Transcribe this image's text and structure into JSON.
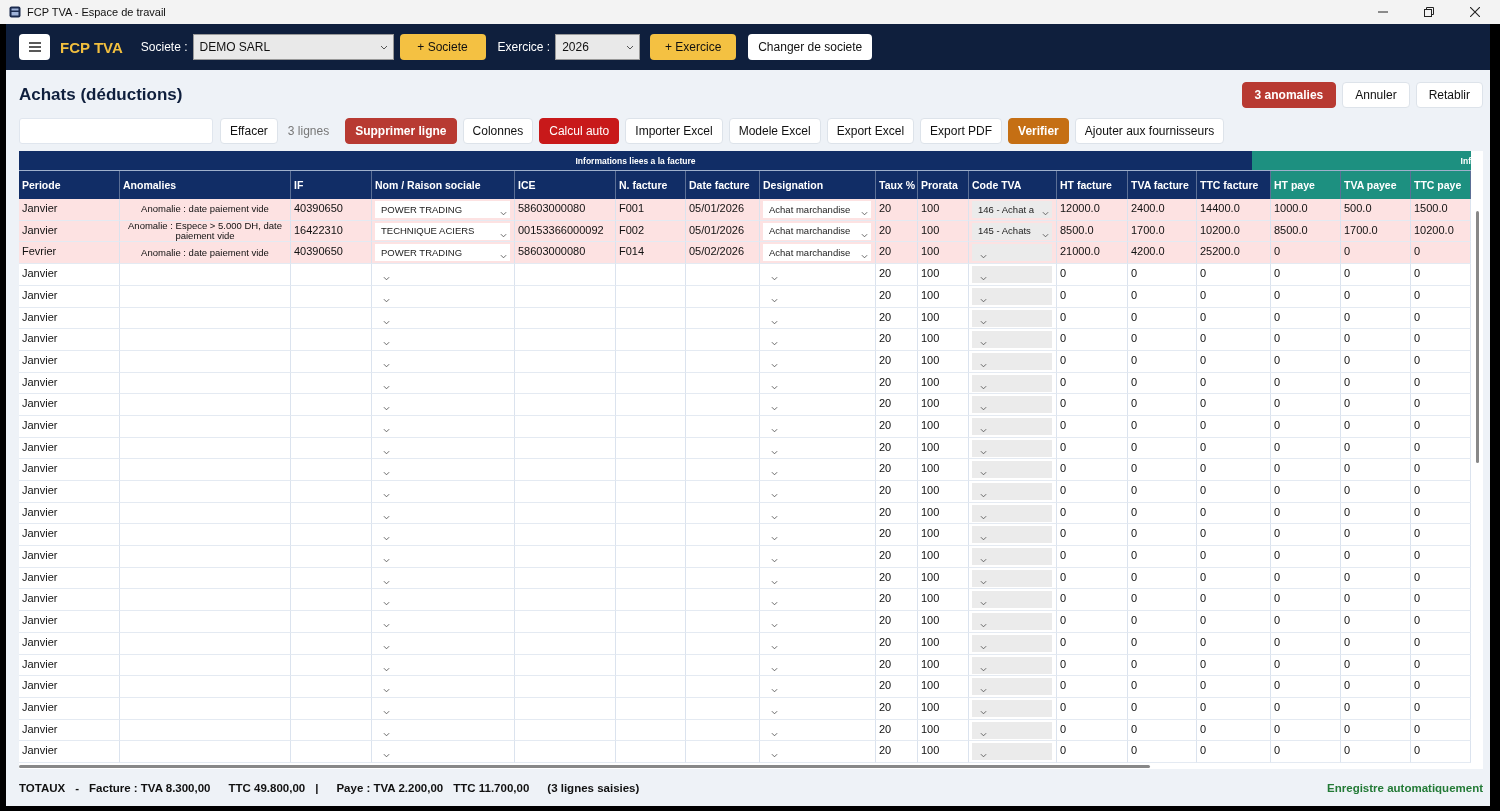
{
  "window": {
    "title": "FCP TVA - Espace de travail"
  },
  "header": {
    "brand": "FCP TVA",
    "company_label": "Societe :",
    "company": "DEMO SARL",
    "add_company": "+ Societe",
    "year_label": "Exercice :",
    "year": "2026",
    "add_year": "+ Exercice",
    "switch_company": "Changer de societe"
  },
  "page_title": "Achats (déductions)",
  "top_actions": [
    {
      "label": "3 anomalies",
      "kind": "danger"
    },
    {
      "label": "Annuler",
      "kind": "plain"
    },
    {
      "label": "Retablir",
      "kind": "plain"
    }
  ],
  "toolbar": {
    "clear": "Effacer",
    "count": "3 lignes",
    "buttons": [
      {
        "label": "Supprimer ligne",
        "kind": "danger"
      },
      {
        "label": "Colonnes",
        "kind": "plain"
      },
      {
        "label": "Calcul auto",
        "kind": "alert"
      },
      {
        "label": "Importer Excel",
        "kind": "plain"
      },
      {
        "label": "Modele Excel",
        "kind": "plain"
      },
      {
        "label": "Export Excel",
        "kind": "plain"
      },
      {
        "label": "Export PDF",
        "kind": "plain"
      },
      {
        "label": "Verifier",
        "kind": "warning"
      },
      {
        "label": "Ajouter aux fournisseurs",
        "kind": "plain"
      }
    ]
  },
  "table": {
    "groups": [
      {
        "label": "Informations liees a la facture",
        "kind": "invoice"
      },
      {
        "label": "Inf",
        "kind": "payment"
      }
    ],
    "columns": [
      {
        "label": "Periode",
        "kind": "text"
      },
      {
        "label": "Anomalies",
        "kind": "note"
      },
      {
        "label": "IF",
        "kind": "text"
      },
      {
        "label": "Nom / Raison sociale",
        "kind": "combo"
      },
      {
        "label": "ICE",
        "kind": "text"
      },
      {
        "label": "N. facture",
        "kind": "text"
      },
      {
        "label": "Date facture",
        "kind": "text"
      },
      {
        "label": "Designation",
        "kind": "combo"
      },
      {
        "label": "Taux %",
        "kind": "text"
      },
      {
        "label": "Prorata",
        "kind": "text"
      },
      {
        "label": "Code TVA",
        "kind": "code"
      },
      {
        "label": "HT facture",
        "kind": "text"
      },
      {
        "label": "TVA facture",
        "kind": "text"
      },
      {
        "label": "TTC facture",
        "kind": "text"
      },
      {
        "label": "HT paye",
        "kind": "paid"
      },
      {
        "label": "TVA payee",
        "kind": "paid"
      },
      {
        "label": "TTC paye",
        "kind": "paid"
      }
    ],
    "rows": [
      {
        "anomaly": true,
        "periode": "Janvier",
        "anomalie": "Anomalie : date paiement vide",
        "if": "40390650",
        "nom": "POWER TRADING",
        "ice": "58603000080",
        "n_facture": "F001",
        "date_facture": "05/01/2026",
        "designation": "Achat marchandise",
        "taux": "20",
        "prorata": "100",
        "code_tva": "146 - Achat a",
        "ht_facture": "12000.0",
        "tva_facture": "2400.0",
        "ttc_facture": "14400.0",
        "ht_paye": "1000.0",
        "tva_payee": "500.0",
        "ttc_paye": "1500.0"
      },
      {
        "anomaly": true,
        "periode": "Janvier",
        "anomalie": "Anomalie : Espece > 5.000 DH, date paiement vide",
        "if": "16422310",
        "nom": "TECHNIQUE ACIERS",
        "ice": "00153366000092",
        "n_facture": "F002",
        "date_facture": "05/01/2026",
        "designation": "Achat marchandise",
        "taux": "20",
        "prorata": "100",
        "code_tva": "145 - Achats",
        "ht_facture": "8500.0",
        "tva_facture": "1700.0",
        "ttc_facture": "10200.0",
        "ht_paye": "8500.0",
        "tva_payee": "1700.0",
        "ttc_paye": "10200.0"
      },
      {
        "anomaly": true,
        "periode": "Fevrier",
        "anomalie": "Anomalie : date paiement vide",
        "if": "40390650",
        "nom": "POWER TRADING",
        "ice": "58603000080",
        "n_facture": "F014",
        "date_facture": "05/02/2026",
        "designation": "Achat marchandise",
        "taux": "20",
        "prorata": "100",
        "ht_facture": "21000.0",
        "tva_facture": "4200.0",
        "ttc_facture": "25200.0",
        "ht_paye": "0",
        "tva_payee": "0",
        "ttc_paye": "0"
      },
      {
        "anomaly": false,
        "periode": "Janvier",
        "taux": "20",
        "prorata": "100",
        "ht_facture": "0",
        "tva_facture": "0",
        "ttc_facture": "0",
        "ht_paye": "0",
        "tva_payee": "0",
        "ttc_paye": "0"
      },
      {
        "anomaly": false,
        "periode": "Janvier",
        "taux": "20",
        "prorata": "100",
        "ht_facture": "0",
        "tva_facture": "0",
        "ttc_facture": "0",
        "ht_paye": "0",
        "tva_payee": "0",
        "ttc_paye": "0"
      },
      {
        "anomaly": false,
        "periode": "Janvier",
        "taux": "20",
        "prorata": "100",
        "ht_facture": "0",
        "tva_facture": "0",
        "ttc_facture": "0",
        "ht_paye": "0",
        "tva_payee": "0",
        "ttc_paye": "0"
      },
      {
        "anomaly": false,
        "periode": "Janvier",
        "taux": "20",
        "prorata": "100",
        "ht_facture": "0",
        "tva_facture": "0",
        "ttc_facture": "0",
        "ht_paye": "0",
        "tva_payee": "0",
        "ttc_paye": "0"
      },
      {
        "anomaly": false,
        "periode": "Janvier",
        "taux": "20",
        "prorata": "100",
        "ht_facture": "0",
        "tva_facture": "0",
        "ttc_facture": "0",
        "ht_paye": "0",
        "tva_payee": "0",
        "ttc_paye": "0"
      },
      {
        "anomaly": false,
        "periode": "Janvier",
        "taux": "20",
        "prorata": "100",
        "ht_facture": "0",
        "tva_facture": "0",
        "ttc_facture": "0",
        "ht_paye": "0",
        "tva_payee": "0",
        "ttc_paye": "0"
      },
      {
        "anomaly": false,
        "periode": "Janvier",
        "taux": "20",
        "prorata": "100",
        "ht_facture": "0",
        "tva_facture": "0",
        "ttc_facture": "0",
        "ht_paye": "0",
        "tva_payee": "0",
        "ttc_paye": "0"
      },
      {
        "anomaly": false,
        "periode": "Janvier",
        "taux": "20",
        "prorata": "100",
        "ht_facture": "0",
        "tva_facture": "0",
        "ttc_facture": "0",
        "ht_paye": "0",
        "tva_payee": "0",
        "ttc_paye": "0"
      },
      {
        "anomaly": false,
        "periode": "Janvier",
        "taux": "20",
        "prorata": "100",
        "ht_facture": "0",
        "tva_facture": "0",
        "ttc_facture": "0",
        "ht_paye": "0",
        "tva_payee": "0",
        "ttc_paye": "0"
      },
      {
        "anomaly": false,
        "periode": "Janvier",
        "taux": "20",
        "prorata": "100",
        "ht_facture": "0",
        "tva_facture": "0",
        "ttc_facture": "0",
        "ht_paye": "0",
        "tva_payee": "0",
        "ttc_paye": "0"
      },
      {
        "anomaly": false,
        "periode": "Janvier",
        "taux": "20",
        "prorata": "100",
        "ht_facture": "0",
        "tva_facture": "0",
        "ttc_facture": "0",
        "ht_paye": "0",
        "tva_payee": "0",
        "ttc_paye": "0"
      },
      {
        "anomaly": false,
        "periode": "Janvier",
        "taux": "20",
        "prorata": "100",
        "ht_facture": "0",
        "tva_facture": "0",
        "ttc_facture": "0",
        "ht_paye": "0",
        "tva_payee": "0",
        "ttc_paye": "0"
      },
      {
        "anomaly": false,
        "periode": "Janvier",
        "taux": "20",
        "prorata": "100",
        "ht_facture": "0",
        "tva_facture": "0",
        "ttc_facture": "0",
        "ht_paye": "0",
        "tva_payee": "0",
        "ttc_paye": "0"
      },
      {
        "anomaly": false,
        "periode": "Janvier",
        "taux": "20",
        "prorata": "100",
        "ht_facture": "0",
        "tva_facture": "0",
        "ttc_facture": "0",
        "ht_paye": "0",
        "tva_payee": "0",
        "ttc_paye": "0"
      },
      {
        "anomaly": false,
        "periode": "Janvier",
        "taux": "20",
        "prorata": "100",
        "ht_facture": "0",
        "tva_facture": "0",
        "ttc_facture": "0",
        "ht_paye": "0",
        "tva_payee": "0",
        "ttc_paye": "0"
      },
      {
        "anomaly": false,
        "periode": "Janvier",
        "taux": "20",
        "prorata": "100",
        "ht_facture": "0",
        "tva_facture": "0",
        "ttc_facture": "0",
        "ht_paye": "0",
        "tva_payee": "0",
        "ttc_paye": "0"
      },
      {
        "anomaly": false,
        "periode": "Janvier",
        "taux": "20",
        "prorata": "100",
        "ht_facture": "0",
        "tva_facture": "0",
        "ttc_facture": "0",
        "ht_paye": "0",
        "tva_payee": "0",
        "ttc_paye": "0"
      },
      {
        "anomaly": false,
        "periode": "Janvier",
        "taux": "20",
        "prorata": "100",
        "ht_facture": "0",
        "tva_facture": "0",
        "ttc_facture": "0",
        "ht_paye": "0",
        "tva_payee": "0",
        "ttc_paye": "0"
      },
      {
        "anomaly": false,
        "periode": "Janvier",
        "taux": "20",
        "prorata": "100",
        "ht_facture": "0",
        "tva_facture": "0",
        "ttc_facture": "0",
        "ht_paye": "0",
        "tva_payee": "0",
        "ttc_paye": "0"
      },
      {
        "anomaly": false,
        "periode": "Janvier",
        "taux": "20",
        "prorata": "100",
        "ht_facture": "0",
        "tva_facture": "0",
        "ttc_facture": "0",
        "ht_paye": "0",
        "tva_payee": "0",
        "ttc_paye": "0"
      },
      {
        "anomaly": false,
        "periode": "Janvier",
        "taux": "20",
        "prorata": "100",
        "ht_facture": "0",
        "tva_facture": "0",
        "ttc_facture": "0",
        "ht_paye": "0",
        "tva_payee": "0",
        "ttc_paye": "0"
      },
      {
        "anomaly": false,
        "periode": "Janvier",
        "taux": "20",
        "prorata": "100",
        "ht_facture": "0",
        "tva_facture": "0",
        "ttc_facture": "0",
        "ht_paye": "0",
        "tva_payee": "0",
        "ttc_paye": "0"
      },
      {
        "anomaly": false,
        "periode": "Janvier",
        "taux": "20",
        "prorata": "100",
        "ht_facture": "0",
        "tva_facture": "0",
        "ttc_facture": "0",
        "ht_paye": "0",
        "tva_payee": "0",
        "ttc_paye": "0"
      }
    ]
  },
  "totals": [
    "TOTAUX",
    "-",
    "Facture : TVA 8.300,00",
    "TTC 49.800,00",
    "|",
    "Paye : TVA 2.200,00",
    "TTC 11.700,00",
    "(3 lignes saisies)"
  ],
  "save_status": "Enregistre automatiquement"
}
